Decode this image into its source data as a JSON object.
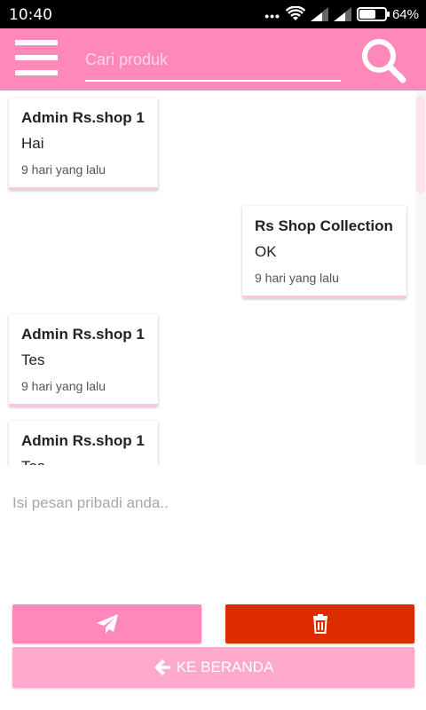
{
  "status_bar": {
    "time": "10:40",
    "battery_percent": 64,
    "battery_label": "64%"
  },
  "app_bar": {
    "search_placeholder": "Cari produk",
    "color": "#ff88bb"
  },
  "messages": [
    {
      "sender": "Admin Rs.shop 1",
      "text": "Hai",
      "time": "9 hari yang lalu",
      "side": "left"
    },
    {
      "sender": "Rs Shop Collection",
      "text": "OK",
      "time": "9 hari yang lalu",
      "side": "right"
    },
    {
      "sender": "Admin Rs.shop 1",
      "text": "Tes",
      "time": "9 hari yang lalu",
      "side": "left"
    },
    {
      "sender": "Admin Rs.shop 1",
      "text": "Tes",
      "time": "",
      "side": "left"
    }
  ],
  "composer": {
    "placeholder": "Isi pesan pribadi anda.."
  },
  "actions": {
    "send_icon": "paper-plane-icon",
    "delete_icon": "trash-icon",
    "home_label": "KE BERANDA",
    "home_icon": "arrow-left-icon",
    "delete_color": "#dd2c00",
    "home_color": "#ffaacc"
  }
}
